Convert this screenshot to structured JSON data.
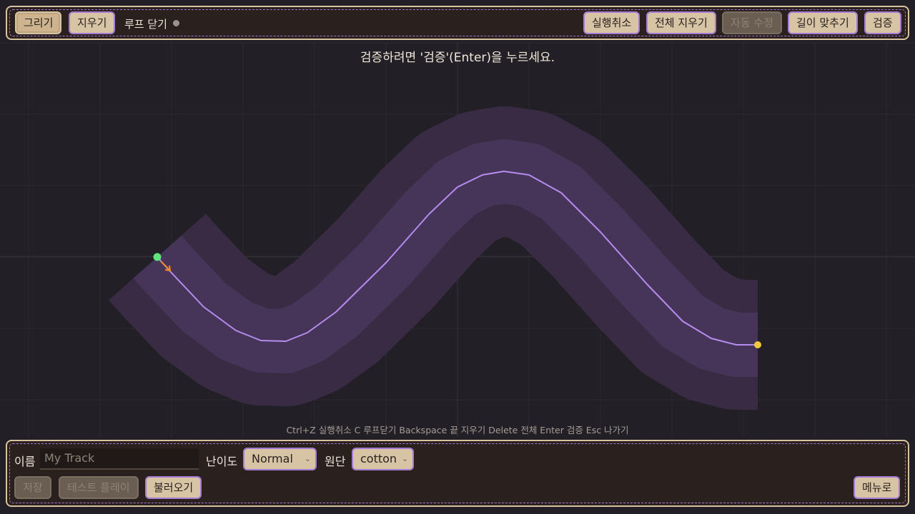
{
  "toolbar": {
    "draw_label": "그리기",
    "erase_label": "지우기",
    "close_loop_label": "루프 닫기",
    "undo_label": "실행취소",
    "clear_all_label": "전체 지우기",
    "auto_fix_label": "자동 수정",
    "fit_length_label": "길이 맞추기",
    "validate_label": "검증"
  },
  "status_message": "검증하려면 '검증'(Enter)을 누르세요.",
  "shortcut_hint": "Ctrl+Z 실행취소   C 루프닫기   Backspace 끝 지우기   Delete 전체   Enter 검증   Esc 나가기",
  "editor": {
    "name_label": "이름",
    "name_value": "",
    "name_placeholder": "My Track",
    "difficulty_label": "난이도",
    "difficulty_value": "Normal",
    "fabric_label": "원단",
    "fabric_value": "cotton",
    "save_label": "저장",
    "test_play_label": "테스트 플레이",
    "load_label": "불러오기",
    "menu_label": "메뉴로"
  },
  "colors": {
    "background": "#221f26",
    "track_outer": "#3a2c45",
    "track_inner": "#47365a",
    "path_line": "#b58cf0",
    "start_marker": "#5fe37c",
    "end_marker": "#f2c93a",
    "direction_arrow": "#f08a2a"
  }
}
